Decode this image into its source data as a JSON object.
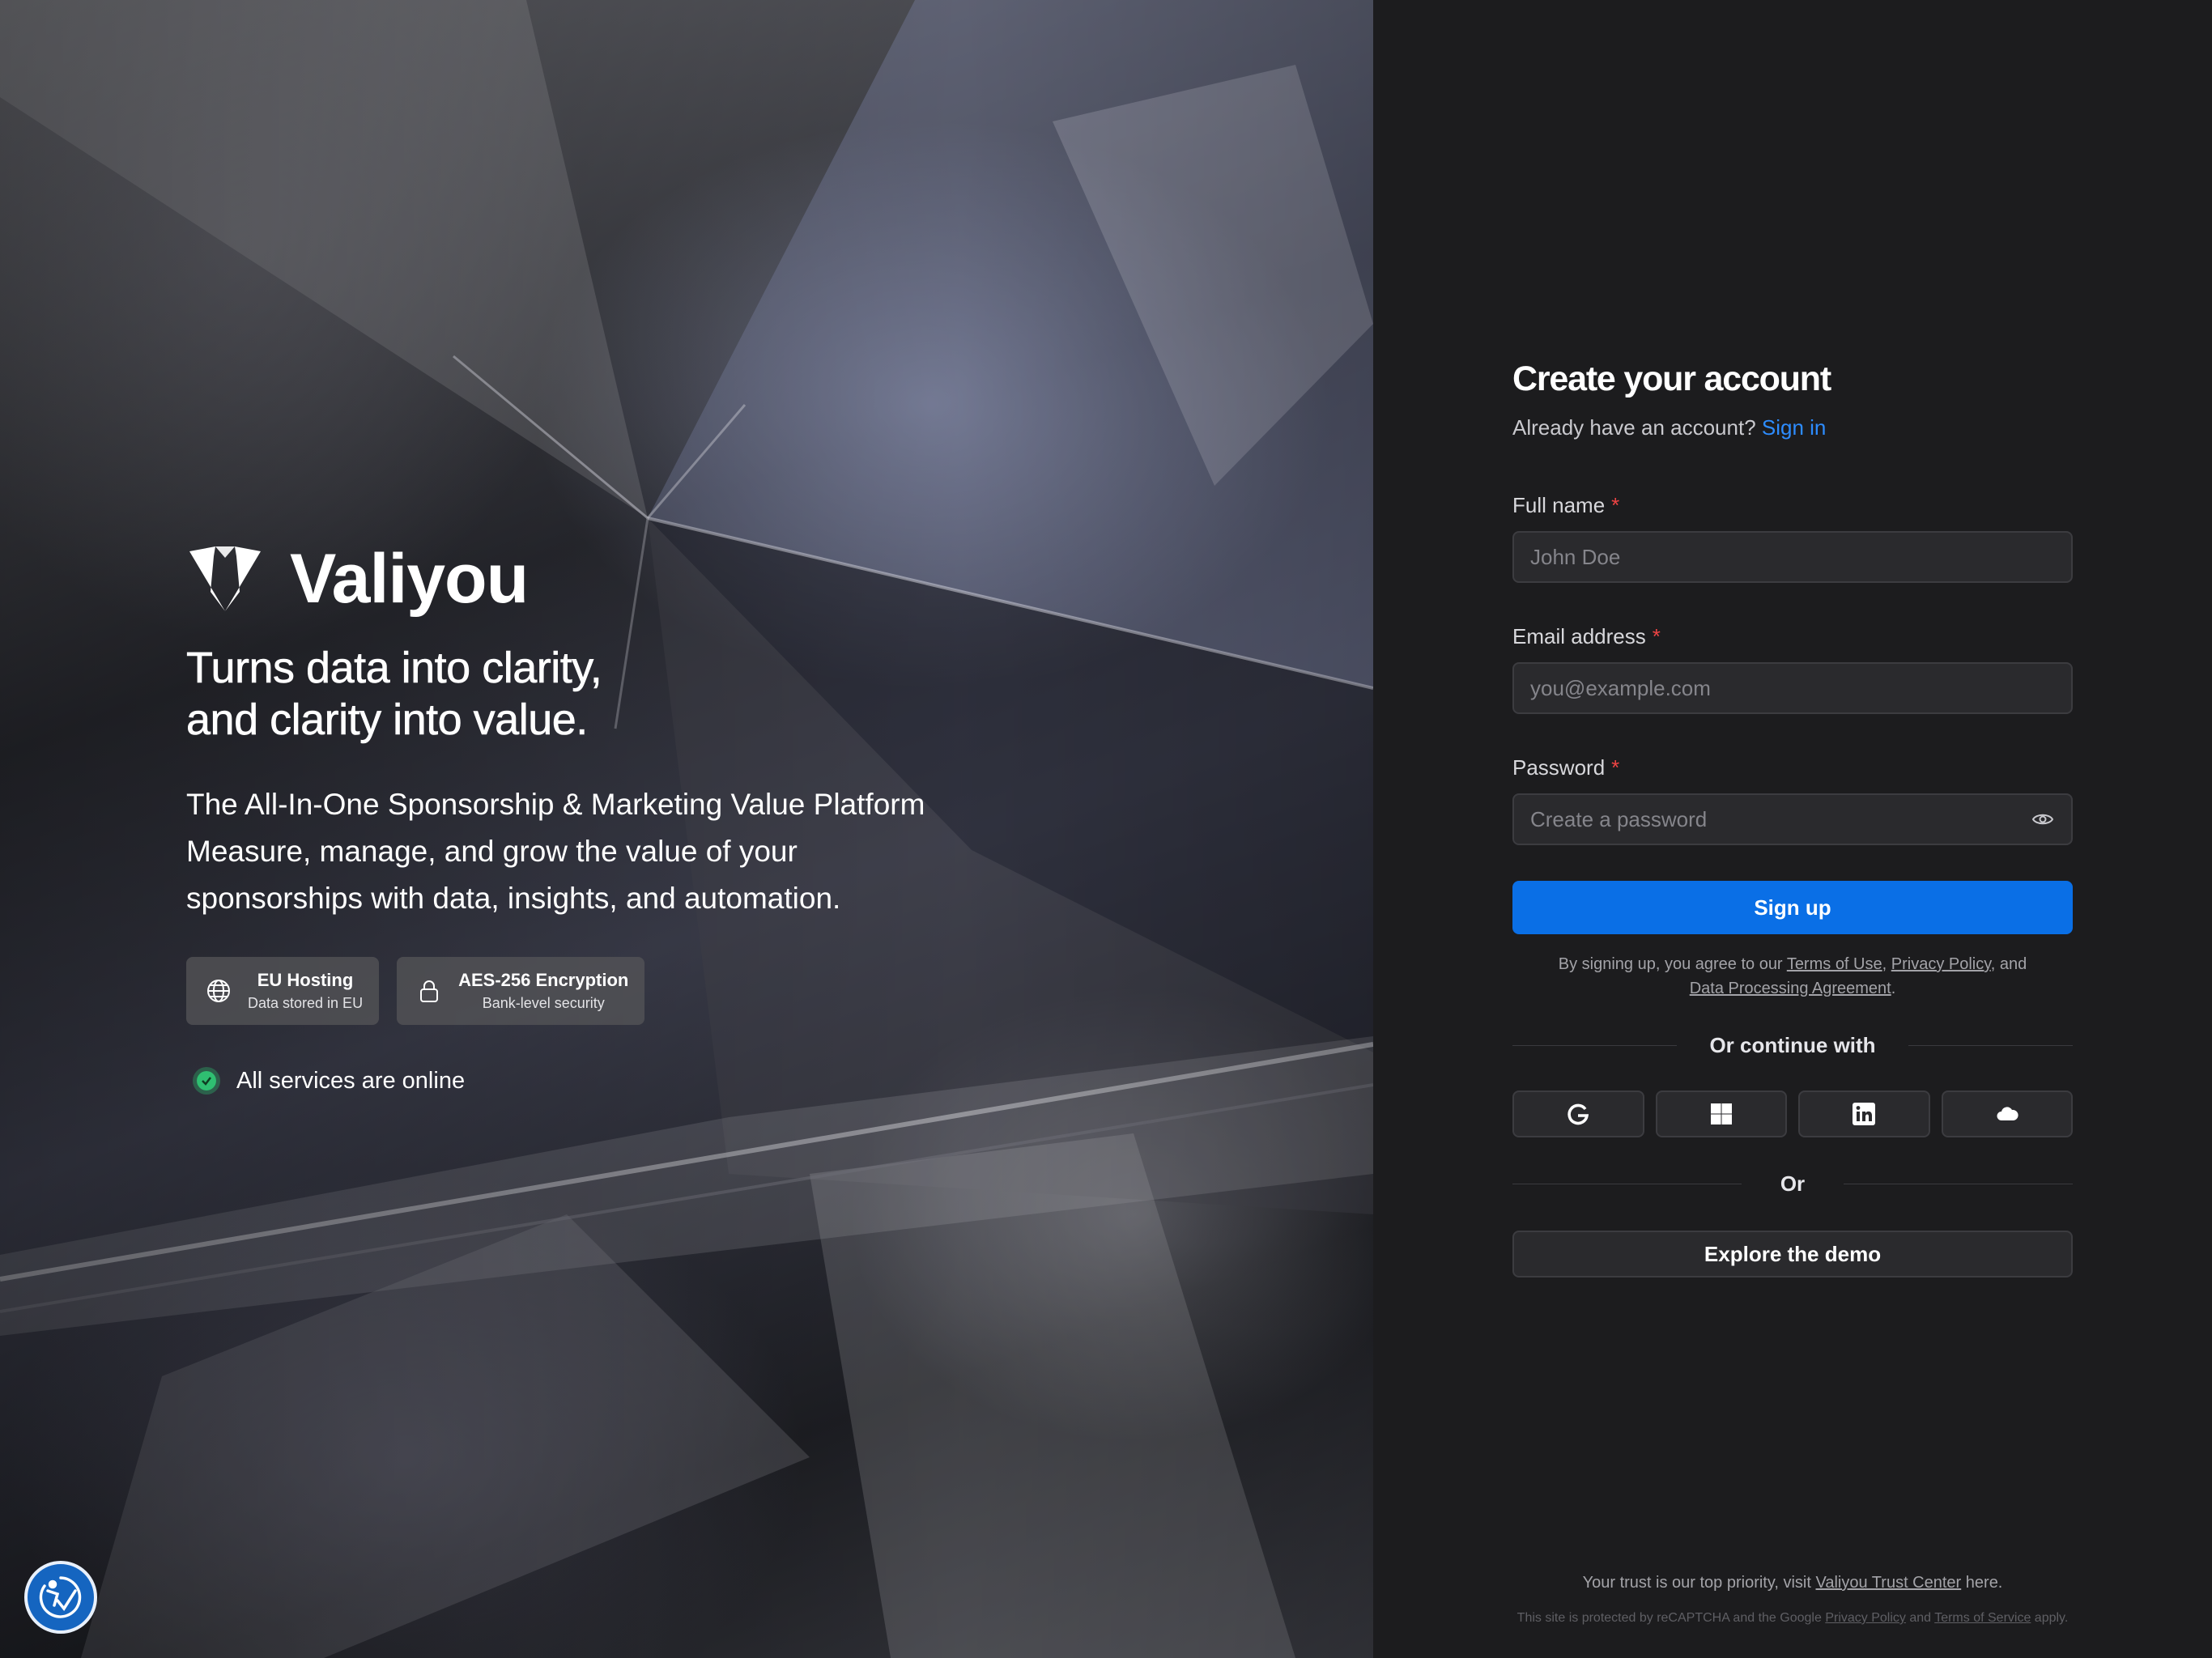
{
  "brand": {
    "name": "Valiyou",
    "logo_icon": "valiyou-gem-logo"
  },
  "hero": {
    "tagline_line1": "Turns data into clarity,",
    "tagline_line2": "and clarity into value.",
    "desc_line1": "The All-In-One Sponsorship & Marketing Value Platform",
    "desc_line2": "Measure, manage, and grow the value of your",
    "desc_line3": "sponsorships with data, insights, and automation.",
    "badges": [
      {
        "icon": "globe-icon",
        "title": "EU Hosting",
        "subtitle": "Data stored in EU"
      },
      {
        "icon": "lock-icon",
        "title": "AES-256 Encryption",
        "subtitle": "Bank-level security"
      }
    ],
    "status": {
      "icon": "check-circle-icon",
      "text": "All services are online",
      "color": "#2fbf71"
    }
  },
  "form": {
    "title": "Create your account",
    "signin_prompt": "Already have an account?",
    "signin_link": "Sign in",
    "fields": {
      "full_name": {
        "label": "Full name",
        "required_mark": "*",
        "placeholder": "John Doe",
        "value": ""
      },
      "email": {
        "label": "Email address",
        "required_mark": "*",
        "placeholder": "you@example.com",
        "value": ""
      },
      "password": {
        "label": "Password",
        "required_mark": "*",
        "placeholder": "Create a password",
        "value": ""
      }
    },
    "signup_button": "Sign up",
    "legal": {
      "prefix": "By signing up, you agree to our",
      "terms": "Terms of Use",
      "comma": ",",
      "privacy": "Privacy Policy",
      "and": ", and",
      "dpa": "Data Processing Agreement",
      "period": "."
    },
    "continue_with": "Or continue with",
    "social_providers": [
      "google-icon",
      "windows-icon",
      "linkedin-icon",
      "cloud-icon"
    ],
    "or_label": "Or",
    "demo_button": "Explore the demo"
  },
  "footer": {
    "trust_prefix": "Your trust is our top priority, visit",
    "trust_link": "Valiyou Trust Center",
    "trust_suffix": "here.",
    "recaptcha_prefix": "This site is protected by reCAPTCHA and the Google",
    "recaptcha_privacy": "Privacy Policy",
    "recaptcha_and": "and",
    "recaptcha_terms": "Terms of Service",
    "recaptcha_suffix": "apply."
  },
  "accessibility_widget": {
    "icon": "accessibility-icon"
  },
  "colors": {
    "accent": "#0a6fe6",
    "link": "#2d8cff",
    "panel_bg": "#1c1c1e",
    "input_bg": "#2a2a2d",
    "required": "#ef4444",
    "success": "#2fbf71"
  }
}
